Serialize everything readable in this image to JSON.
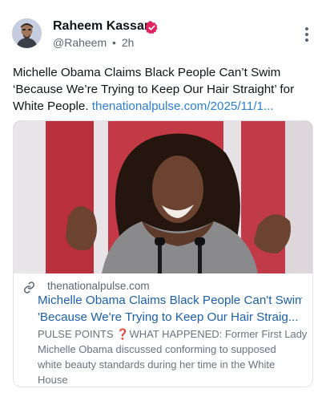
{
  "author": {
    "name": "Raheem Kassam",
    "handle": "@Raheem",
    "separator": "•",
    "time": "2h"
  },
  "post": {
    "text": "Michelle Obama Claims Black People Can’t Swim ‘Because We’re Trying to Keep Our Hair Straight’ for White People.",
    "link_text": "thenationalpulse.com/2025/11/1..."
  },
  "card": {
    "domain": "thenationalpulse.com",
    "title_lines": [
      "Michelle Obama Claims Black People Can't Swim",
      "'Because We're Trying to Keep Our Hair Straig..."
    ],
    "desc_lines": {
      "line1_prefix": "PULSE POINTS ",
      "line1_emoji": "❓",
      "line1_suffix": "WHAT HAPPENED: Former First Lady",
      "line2": "Michelle Obama discussed conforming to supposed",
      "line3": "white beauty standards during her time in the White",
      "line4": "House"
    }
  },
  "colors": {
    "link": "#2a7fd4",
    "card_title": "#1b5fa8",
    "badge": "#e0245e",
    "muted": "#5b6470"
  },
  "icons": {
    "verified": "verified-badge-icon",
    "more": "more-vertical-icon",
    "link": "link-icon"
  }
}
